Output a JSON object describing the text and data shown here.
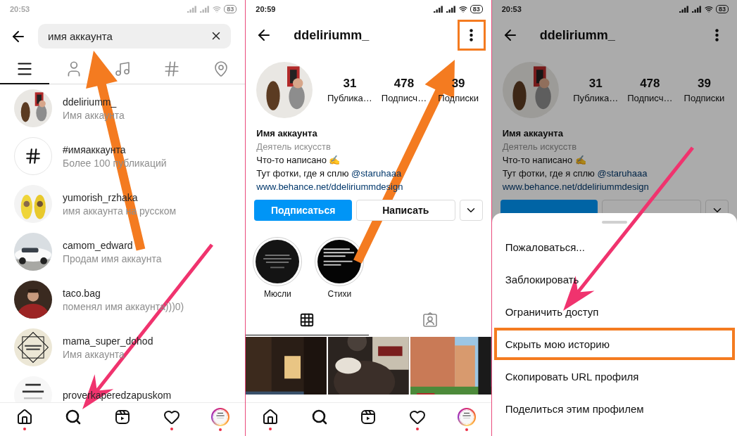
{
  "panels": [
    {
      "kind": "search",
      "status_bar": {
        "time": "20:53",
        "battery": "83",
        "faded": true
      },
      "search": {
        "value": "имя аккаунта"
      },
      "tabs": [
        {
          "selected": true
        },
        {
          "selected": false
        },
        {
          "selected": false
        },
        {
          "selected": false
        },
        {
          "selected": false
        }
      ],
      "results": [
        {
          "kind": "picture",
          "name": "ddeliriumm_",
          "subtitle": "Имя аккаунта"
        },
        {
          "kind": "hashtag",
          "name": "#имяаккаунта",
          "subtitle": "Более 100 публикаций"
        },
        {
          "kind": "picture",
          "name": "yumorish_rzhaka",
          "subtitle": "имя аккаунта на русском"
        },
        {
          "kind": "picture",
          "name": "camom_edward",
          "subtitle": "Продам имя аккаунта"
        },
        {
          "kind": "picture",
          "name": "taco.bag",
          "subtitle": "поменял имя аккаунта)))0)"
        },
        {
          "kind": "picture",
          "name": "mama_super_dohod",
          "subtitle": "Имя аккаунта"
        },
        {
          "kind": "picture",
          "name": "proverkaperedzapuskom"
        }
      ],
      "nav": [
        {
          "dot": true
        },
        {
          "dot": false
        },
        {
          "dot": false
        },
        {
          "dot": true
        },
        {
          "dot": true
        }
      ]
    },
    {
      "kind": "profile",
      "status_bar": {
        "time": "20:59",
        "battery": "83",
        "faded": false
      },
      "username": "ddeliriumm_",
      "more_button": {
        "highlighted": true
      },
      "stats": [
        {
          "value": "31",
          "label": "Публика…"
        },
        {
          "value": "478",
          "label": "Подписч…"
        },
        {
          "value": "39",
          "label": "Подписки"
        }
      ],
      "bio": {
        "name": "Имя аккаунта",
        "category": "Деятель искусств",
        "lines": [
          {
            "text": "Что-то написано ✍"
          },
          {
            "text": "Тут фотки, где я сплю ",
            "mention": "@staruhaaa"
          }
        ],
        "link": "www.behance.net/ddeliriummdesign"
      },
      "actions": [
        {
          "kind": "follow",
          "label": "Подписаться"
        },
        {
          "kind": "message",
          "label": "Написать"
        },
        {
          "kind": "more"
        }
      ],
      "highlights": [
        {
          "label": "Мюсли"
        },
        {
          "label": "Стихи"
        }
      ],
      "content_tabs": [
        {
          "selected": true
        },
        {
          "selected": false
        }
      ],
      "posts": [
        {
          "kind": "picture"
        },
        {
          "kind": "picture"
        },
        {
          "kind": "picture"
        }
      ],
      "nav": [
        {
          "dot": true
        },
        {
          "dot": false
        },
        {
          "dot": false
        },
        {
          "dot": true
        },
        {
          "dot": true
        }
      ]
    },
    {
      "kind": "profile",
      "status_bar": {
        "time": "20:53",
        "battery": "83",
        "faded": false
      },
      "username": "ddeliriumm_",
      "more_button": {
        "highlighted": false
      },
      "stats": [
        {
          "value": "31",
          "label": "Публика…"
        },
        {
          "value": "478",
          "label": "Подписч…"
        },
        {
          "value": "39",
          "label": "Подписки"
        }
      ],
      "bio": {
        "name": "Имя аккаунта",
        "category": "Деятель искусств",
        "lines": [
          {
            "text": "Что-то написано ✍"
          },
          {
            "text": "Тут фотки, где я сплю ",
            "mention": "@staruhaaa"
          }
        ],
        "link": "www.behance.net/ddeliriummdesign"
      },
      "actions": [
        {
          "kind": "follow"
        },
        {
          "kind": "message"
        },
        {
          "kind": "more"
        }
      ],
      "sheet": {
        "items": [
          {
            "label": "Пожаловаться...",
            "highlighted": false
          },
          {
            "label": "Заблокировать",
            "highlighted": false
          },
          {
            "label": "Ограничить доступ",
            "highlighted": false
          },
          {
            "label": "Скрыть мою историю",
            "highlighted": true
          },
          {
            "label": "Скопировать URL профиля",
            "highlighted": false
          },
          {
            "label": "Поделиться этим профилем",
            "highlighted": false
          }
        ]
      }
    }
  ],
  "annotations": [
    {
      "kind": "arrow",
      "color": "#f47b20"
    },
    {
      "kind": "arrow",
      "color": "#f0336e"
    },
    {
      "kind": "arrow",
      "color": "#f47b20"
    },
    {
      "kind": "arrow",
      "color": "#f0336e"
    }
  ]
}
